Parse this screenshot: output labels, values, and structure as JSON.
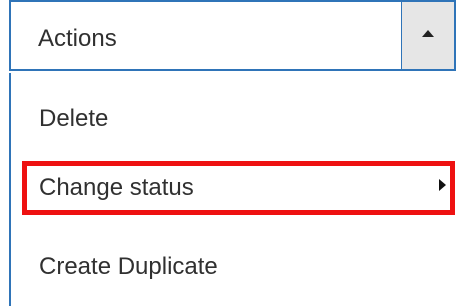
{
  "actions": {
    "label": "Actions",
    "expanded": true,
    "toggle_icon": "triangle-up-icon"
  },
  "menu": {
    "items": [
      {
        "label": "Delete"
      },
      {
        "label": "Change status",
        "submenu_icon": "triangle-right-icon"
      },
      {
        "label": "Create Duplicate"
      }
    ]
  },
  "colors": {
    "focus_border": "#2f74b8",
    "toggle_background": "#e6e6e6",
    "highlight": "#ee1111",
    "text": "#303030"
  }
}
